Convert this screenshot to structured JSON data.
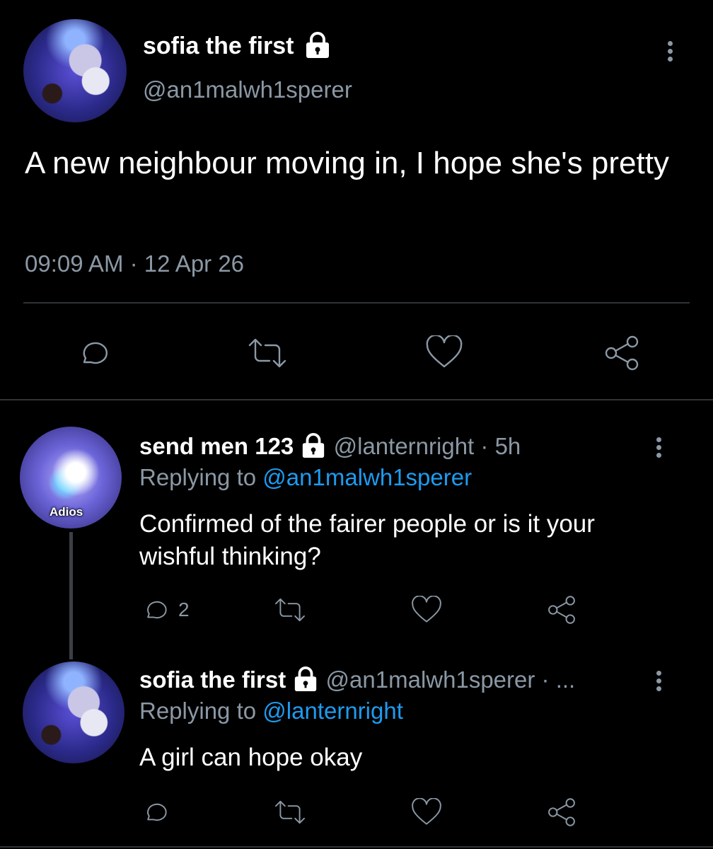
{
  "main_tweet": {
    "display_name": "sofia the first",
    "handle": "@an1malwh1sperer",
    "text": "A new neighbour moving in, I hope she's pretty",
    "timestamp": "09:09 AM · 12 Apr 26",
    "protected_icon": "lock-icon",
    "actions": [
      "reply-icon",
      "retweet-icon",
      "like-icon",
      "share-icon"
    ]
  },
  "replies": [
    {
      "display_name": "send men 123",
      "handle": "@lanternright",
      "separator": "·",
      "time": "5h",
      "replying_prefix": "Replying to",
      "replying_to": "@an1malwh1sperer",
      "text_line1": "Confirmed of the fairer people or is it your",
      "text_line2": "wishful thinking?",
      "reply_count": "2",
      "avatar_badge": "Adios"
    },
    {
      "display_name": "sofia the first",
      "handle": "@an1malwh1sperer",
      "separator": "·",
      "time": "...",
      "replying_prefix": "Replying to",
      "replying_to": "@lanternright",
      "text_line1": "A girl can hope okay"
    }
  ]
}
